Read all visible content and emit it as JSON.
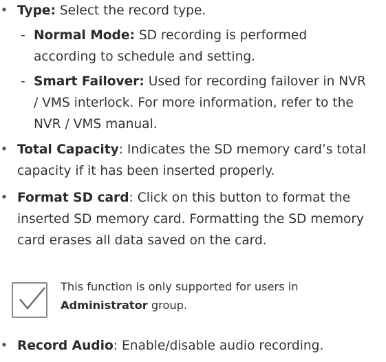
{
  "items": {
    "type": {
      "label": "Type:",
      "text": " Select the record type."
    },
    "normal_mode": {
      "label": "Normal Mode:",
      "text1": " SD recording is performed",
      "text2": "according to schedule and setting."
    },
    "smart_failover": {
      "label": "Smart Failover:",
      "text1": " Used for recording failover in NVR",
      "text2": "/ VMS interlock. For more information, refer to the",
      "text3": "NVR / VMS manual."
    },
    "total_capacity": {
      "label": "Total Capacity",
      "text1": ": Indicates the SD memory card’s total",
      "text2": "capacity if it has been inserted properly."
    },
    "format_sd": {
      "label": "Format SD card",
      "text1": ": Click on this button to format the",
      "text2": "inserted SD memory card. Formatting the SD memory",
      "text3": "card erases all data saved on the card."
    },
    "record_audio": {
      "label": "Record Audio",
      "text": ": Enable/disable audio recording."
    }
  },
  "note": {
    "icon": "checkmark-icon",
    "line1": "This function is only supported for users in",
    "line2_bold": "Administrator",
    "line2_rest": " group."
  },
  "symbols": {
    "bullet": "•",
    "dash": "-"
  },
  "colors": {
    "text": "#333333",
    "icon_border": "#8a8a8a"
  }
}
